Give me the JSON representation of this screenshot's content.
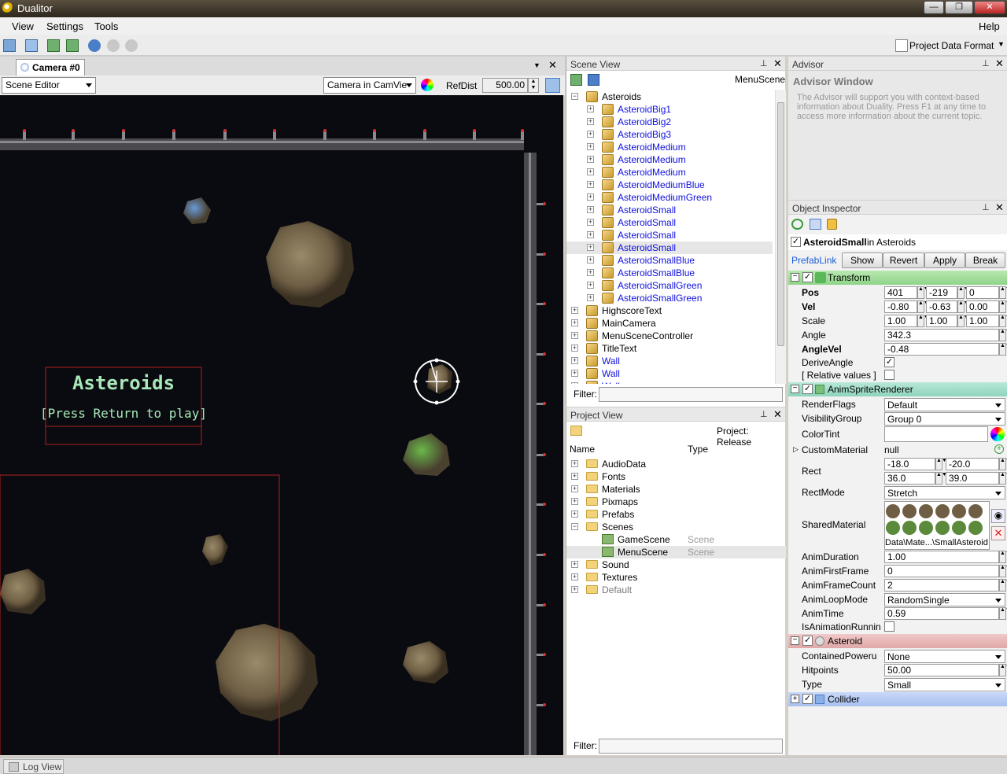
{
  "window": {
    "title": "Dualitor",
    "controls": [
      "—",
      "❐",
      "✕"
    ]
  },
  "menu": {
    "items": [
      "View",
      "Settings",
      "Tools"
    ],
    "help": "Help"
  },
  "toolbar": {
    "project_format": "Project Data Format"
  },
  "camera": {
    "tab_label": "Camera #0",
    "mode": "Scene Editor",
    "camera_select": "Camera in CamVie",
    "refdist_label": "RefDist",
    "refdist_value": "500.00",
    "game_title": "Asteroids",
    "game_prompt": "[Press Return to play]"
  },
  "scene_view": {
    "title": "Scene View",
    "scene_name": "MenuScene",
    "filter_label": "Filter:",
    "root": "Asteroids",
    "children": [
      "AsteroidBig1",
      "AsteroidBig2",
      "AsteroidBig3",
      "AsteroidMedium",
      "AsteroidMedium",
      "AsteroidMedium",
      "AsteroidMediumBlue",
      "AsteroidMediumGreen",
      "AsteroidSmall",
      "AsteroidSmall",
      "AsteroidSmall",
      "AsteroidSmall",
      "AsteroidSmallBlue",
      "AsteroidSmallBlue",
      "AsteroidSmallGreen",
      "AsteroidSmallGreen"
    ],
    "others": [
      "HighscoreText",
      "MainCamera",
      "MenuSceneController",
      "TitleText"
    ],
    "walls": [
      "Wall",
      "Wall",
      "Wall"
    ]
  },
  "project_view": {
    "title": "Project View",
    "project": "Project: Release",
    "col_name": "Name",
    "col_type": "Type",
    "filter_label": "Filter:",
    "folders": [
      "AudioData",
      "Fonts",
      "Materials",
      "Pixmaps",
      "Prefabs",
      "Scenes"
    ],
    "scenes": [
      {
        "name": "GameScene",
        "type": "Scene"
      },
      {
        "name": "MenuScene",
        "type": "Scene"
      }
    ],
    "after": [
      "Sound",
      "Textures",
      "Default"
    ]
  },
  "advisor": {
    "title": "Advisor",
    "heading": "Advisor Window",
    "text": "The Advisor will support you with context-based information about Duality. Press F1 at any time to access more information about the current topic."
  },
  "inspector": {
    "title": "Object Inspector",
    "object_name": "AsteroidSmall",
    "object_parent": "in Asteroids",
    "prefab_link": "PrefabLink",
    "buttons": [
      "Show",
      "Revert",
      "Apply",
      "Break"
    ],
    "transform": {
      "header": "Transform",
      "pos_label": "Pos",
      "pos": [
        "401",
        "-219",
        "0"
      ],
      "vel_label": "Vel",
      "vel": [
        "-0.80",
        "-0.63",
        "0.00"
      ],
      "scale_label": "Scale",
      "scale": [
        "1.00",
        "1.00",
        "1.00"
      ],
      "angle_label": "Angle",
      "angle": "342.3",
      "anglevel_label": "AngleVel",
      "anglevel": "-0.48",
      "derive_label": "DeriveAngle",
      "relative_label": "[ Relative values ]"
    },
    "anim": {
      "header": "AnimSpriteRenderer",
      "renderflags_label": "RenderFlags",
      "renderflags": "Default",
      "visgroup_label": "VisibilityGroup",
      "visgroup": "Group 0",
      "colortint_label": "ColorTint",
      "custommat_label": "CustomMaterial",
      "custommat": "null",
      "rect_label": "Rect",
      "rect": [
        "-18.0",
        "-20.0",
        "36.0",
        "39.0"
      ],
      "rectmode_label": "RectMode",
      "rectmode": "Stretch",
      "sharedmat_label": "SharedMaterial",
      "sharedmat": "Data\\Mate...\\SmallAsteroid",
      "animduration_label": "AnimDuration",
      "animduration": "1.00",
      "firstframe_label": "AnimFirstFrame",
      "firstframe": "0",
      "framecount_label": "AnimFrameCount",
      "framecount": "2",
      "loopmode_label": "AnimLoopMode",
      "loopmode": "RandomSingle",
      "animtime_label": "AnimTime",
      "animtime": "0.59",
      "isrunning_label": "IsAnimationRunnin"
    },
    "asteroid": {
      "header": "Asteroid",
      "powerup_label": "ContainedPoweru",
      "powerup": "None",
      "hitpoints_label": "Hitpoints",
      "hitpoints": "50.00",
      "type_label": "Type",
      "type": "Small"
    },
    "collider": {
      "header": "Collider"
    }
  },
  "status": {
    "log_view": "Log View"
  }
}
